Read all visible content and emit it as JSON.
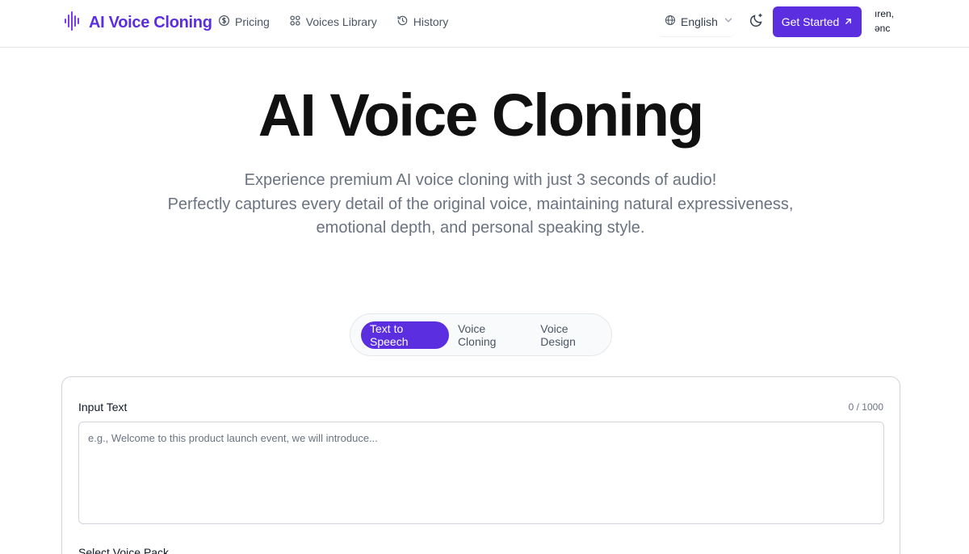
{
  "colors": {
    "accent": "#5b2ee0",
    "text": "#111827",
    "muted": "#6b7280",
    "border": "#d1d5db"
  },
  "header": {
    "brand_name": "AI Voice Cloning",
    "brand_icon": "waveform-icon",
    "nav": [
      {
        "label": "Pricing",
        "icon": "dollar-circle-icon"
      },
      {
        "label": "Voices Library",
        "icon": "grid-icon"
      },
      {
        "label": "History",
        "icon": "history-icon"
      }
    ],
    "language": "English",
    "cta_label": "Get Started",
    "user_snippet_line1": "ıren,",
    "user_snippet_line2": "ənc"
  },
  "hero": {
    "title": "AI Voice Cloning",
    "subtitle_line1": "Experience premium AI voice cloning with just 3 seconds of audio!",
    "subtitle_line2": "Perfectly captures every detail of the original voice, maintaining natural expressiveness,",
    "subtitle_line3": "emotional depth, and personal speaking style."
  },
  "tabs": [
    {
      "label": "Text to Speech",
      "active": true
    },
    {
      "label": "Voice Cloning",
      "active": false
    },
    {
      "label": "Voice Design",
      "active": false
    }
  ],
  "form": {
    "input_label": "Input Text",
    "counter": "0 / 1000",
    "placeholder": "e.g., Welcome to this product launch event, we will introduce...",
    "voice_pack_label": "Select Voice Pack"
  }
}
